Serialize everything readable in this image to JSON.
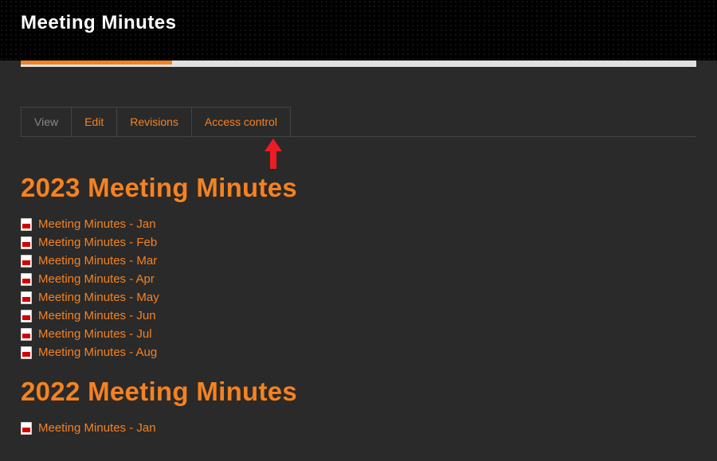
{
  "header": {
    "title": "Meeting Minutes"
  },
  "tabs": [
    {
      "label": "View",
      "active": true
    },
    {
      "label": "Edit",
      "active": false
    },
    {
      "label": "Revisions",
      "active": false
    },
    {
      "label": "Access control",
      "active": false
    }
  ],
  "sections": [
    {
      "heading": "2023 Meeting Minutes",
      "files": [
        {
          "label": "Meeting Minutes - Jan"
        },
        {
          "label": "Meeting Minutes - Feb"
        },
        {
          "label": "Meeting Minutes - Mar"
        },
        {
          "label": "Meeting Minutes - Apr"
        },
        {
          "label": "Meeting Minutes - May"
        },
        {
          "label": "Meeting Minutes - Jun"
        },
        {
          "label": "Meeting Minutes - Jul"
        },
        {
          "label": "Meeting Minutes - Aug"
        }
      ]
    },
    {
      "heading": "2022 Meeting Minutes",
      "files": [
        {
          "label": "Meeting Minutes - Jan"
        }
      ]
    }
  ]
}
